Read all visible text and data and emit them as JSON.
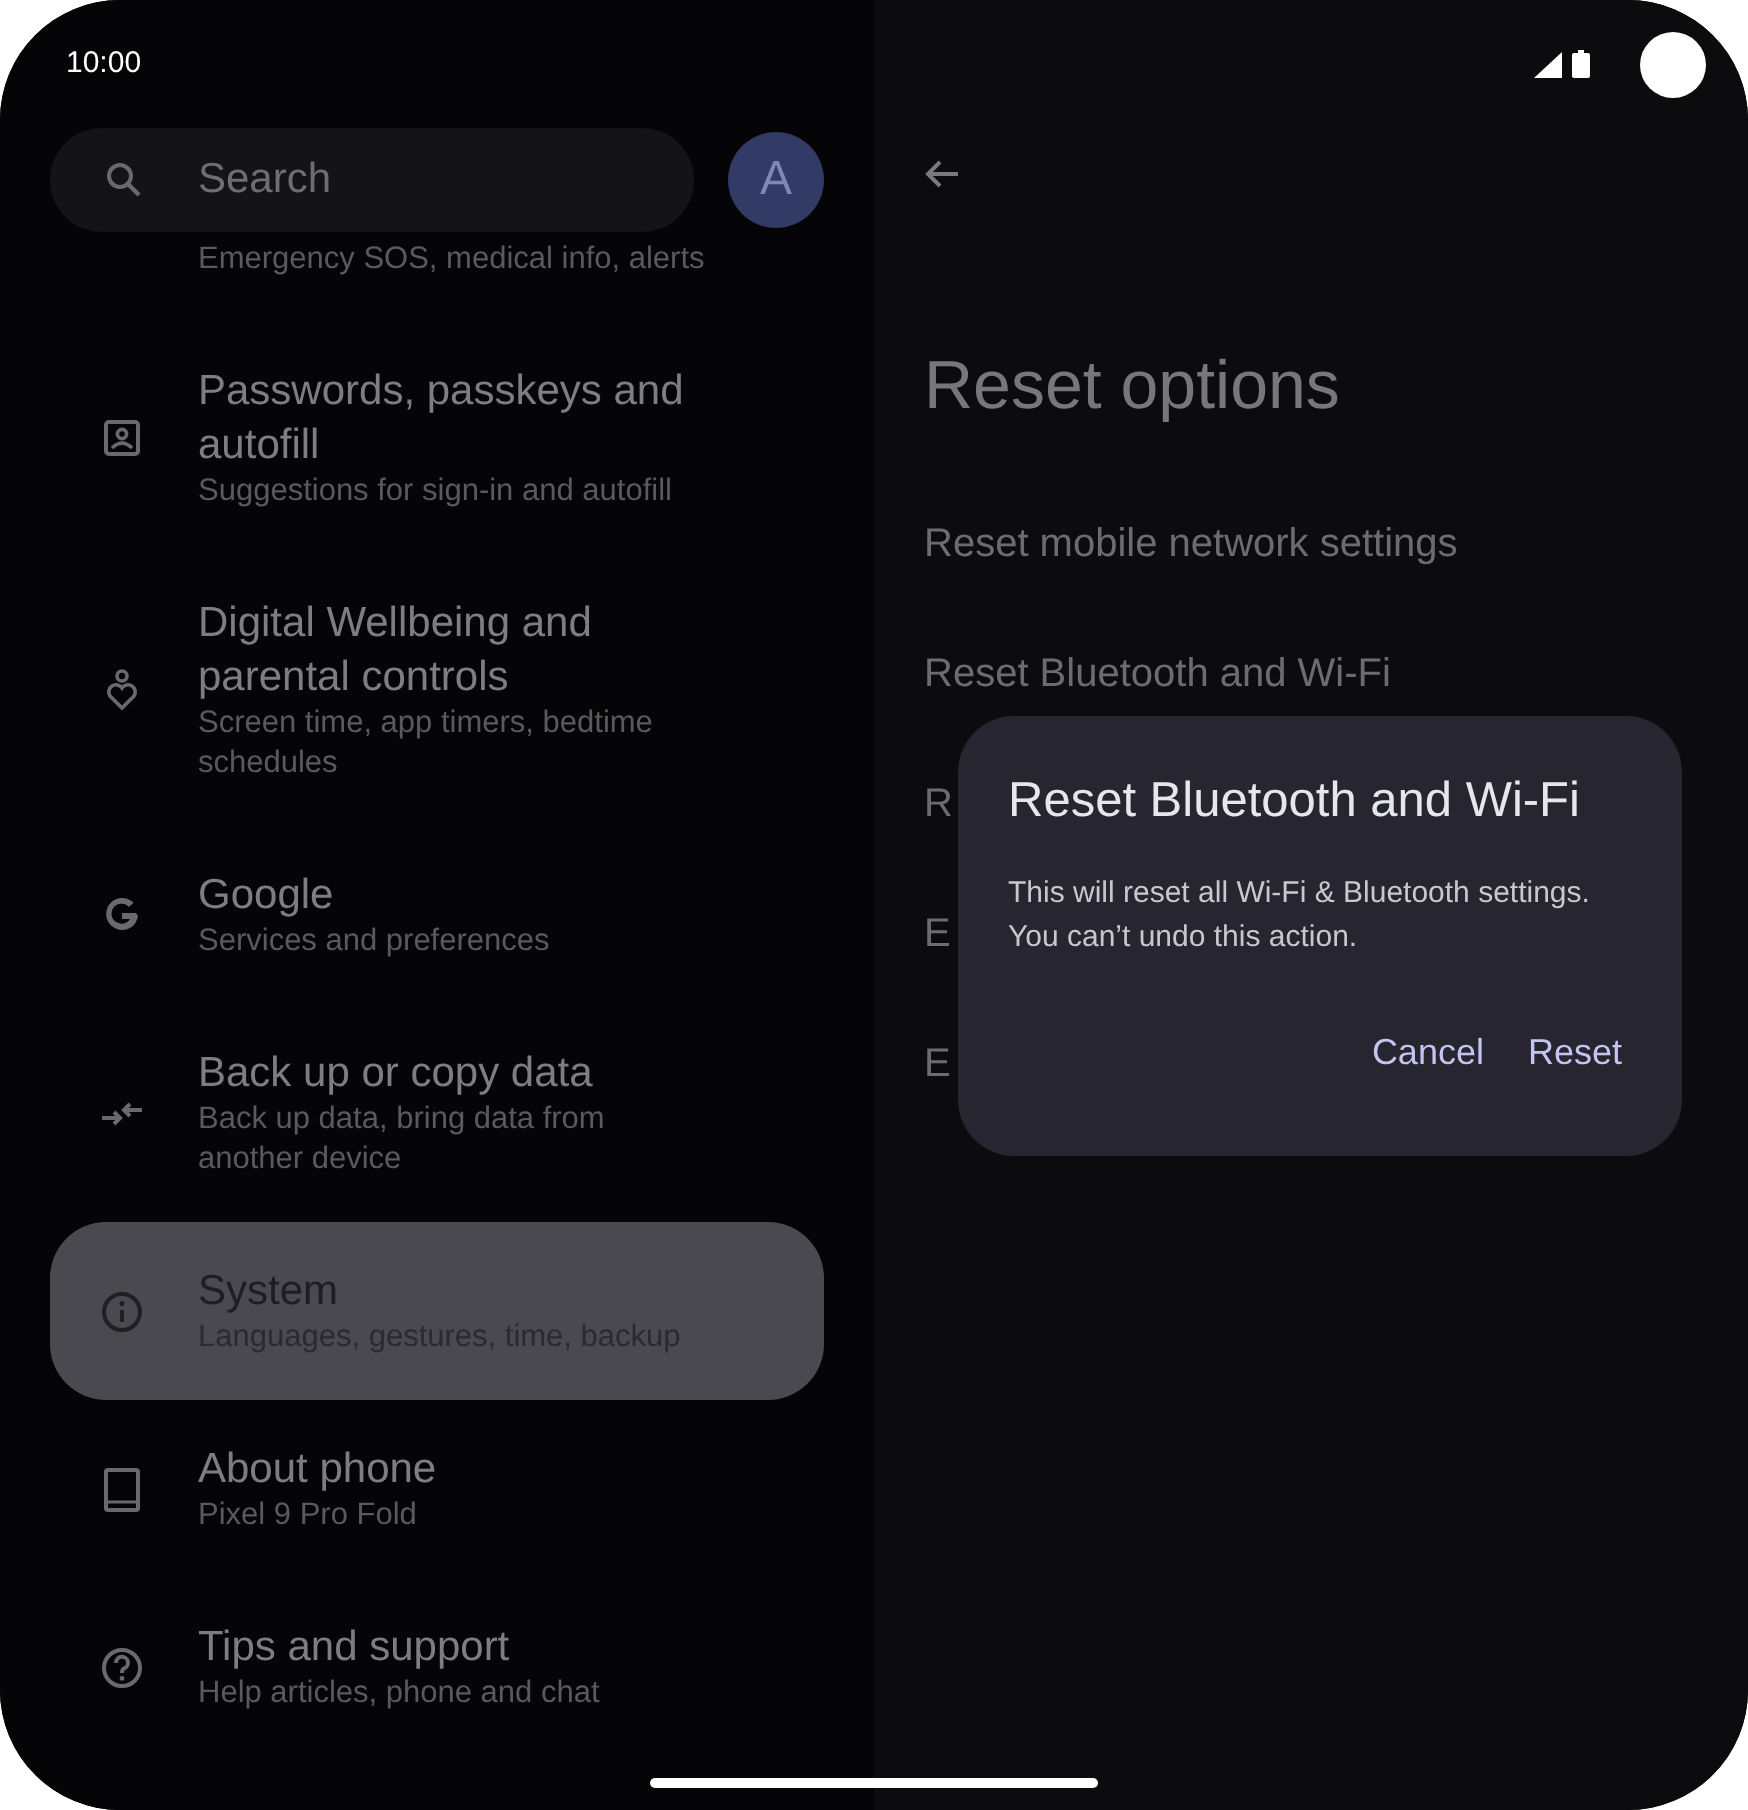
{
  "status_bar": {
    "time": "10:00"
  },
  "search": {
    "placeholder": "Search"
  },
  "avatar": {
    "initial": "A"
  },
  "settings_list": [
    {
      "subtitle": "Emergency SOS, medical info, alerts",
      "selected": false
    },
    {
      "title": "Passwords, passkeys and autofill",
      "subtitle": "Suggestions for sign-in and autofill",
      "selected": false
    },
    {
      "title": "Digital Wellbeing and parental controls",
      "subtitle": "Screen time, app timers, bedtime schedules",
      "selected": false
    },
    {
      "title": "Google",
      "subtitle": "Services and preferences",
      "selected": false
    },
    {
      "title": "Back up or copy data",
      "subtitle": "Back up data, bring data from another device",
      "selected": false
    },
    {
      "title": "System",
      "subtitle": "Languages, gestures, time, backup",
      "selected": true
    },
    {
      "title": "About phone",
      "subtitle": "Pixel 9 Pro Fold",
      "selected": false
    },
    {
      "title": "Tips and support",
      "subtitle": "Help articles, phone and chat",
      "selected": false
    }
  ],
  "page": {
    "title": "Reset options",
    "options": [
      "Reset mobile network settings",
      "Reset Bluetooth and Wi-Fi",
      "R",
      "E",
      "E"
    ]
  },
  "dialog": {
    "title": "Reset Bluetooth and Wi-Fi",
    "message": "This will reset all Wi-Fi & Bluetooth settings. You can’t undo this action.",
    "buttons": [
      "Cancel",
      "Reset"
    ]
  }
}
